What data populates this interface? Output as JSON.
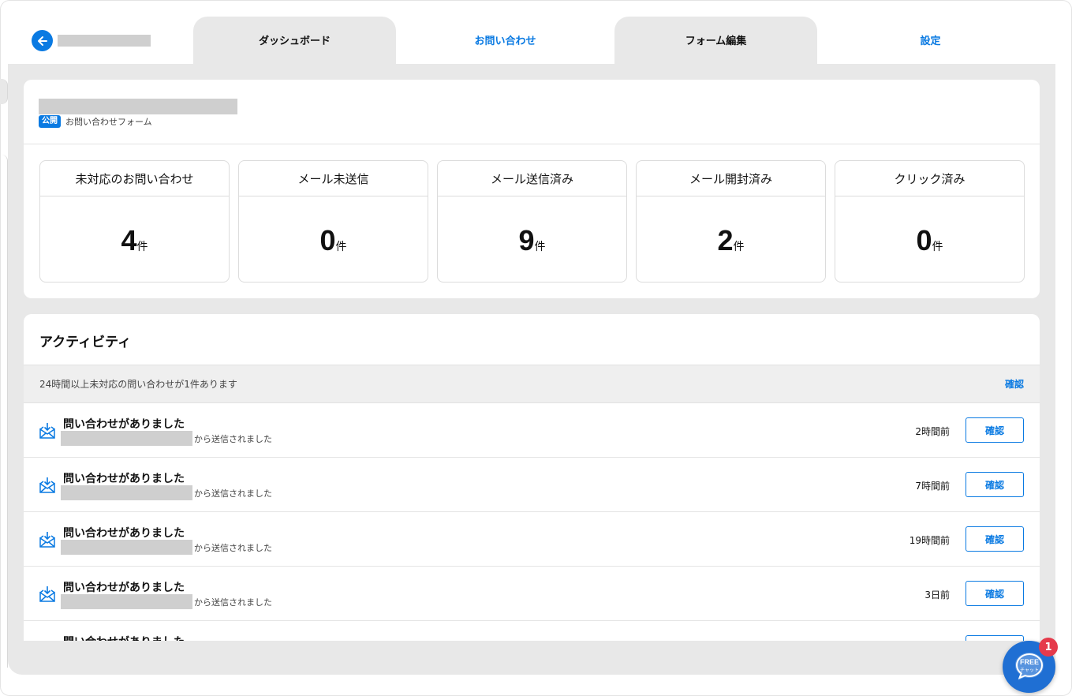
{
  "header": {
    "tabs": [
      {
        "label": "ダッシュボード"
      },
      {
        "label": "お問い合わせ"
      },
      {
        "label": "フォーム編集"
      },
      {
        "label": "設定"
      }
    ]
  },
  "form": {
    "status_badge": "公開",
    "type": "お問い合わせフォーム"
  },
  "stats": [
    {
      "title": "未対応のお問い合わせ",
      "value": "4",
      "unit": "件"
    },
    {
      "title": "メール未送信",
      "value": "0",
      "unit": "件"
    },
    {
      "title": "メール送信済み",
      "value": "9",
      "unit": "件"
    },
    {
      "title": "メール開封済み",
      "value": "2",
      "unit": "件"
    },
    {
      "title": "クリック済み",
      "value": "0",
      "unit": "件"
    }
  ],
  "activity": {
    "title": "アクティビティ",
    "alert_text": "24時間以上未対応の問い合わせが1件あります",
    "alert_action": "確認",
    "rows": [
      {
        "title": "問い合わせがありました",
        "from_suffix": "から送信されました",
        "time": "2時間前",
        "action": "確認"
      },
      {
        "title": "問い合わせがありました",
        "from_suffix": "から送信されました",
        "time": "7時間前",
        "action": "確認"
      },
      {
        "title": "問い合わせがありました",
        "from_suffix": "から送信されました",
        "time": "19時間前",
        "action": "確認"
      },
      {
        "title": "問い合わせがありました",
        "from_suffix": "から送信されました",
        "time": "3日前",
        "action": "確認"
      },
      {
        "title": "問い合わせがありました",
        "from_suffix": "",
        "time": "",
        "action": ""
      }
    ]
  },
  "chat": {
    "label_top": "FREE",
    "label_bottom": "チャット",
    "badge_count": "1"
  },
  "colors": {
    "accent": "#0a7ae2",
    "badge": "#e53a4b"
  }
}
